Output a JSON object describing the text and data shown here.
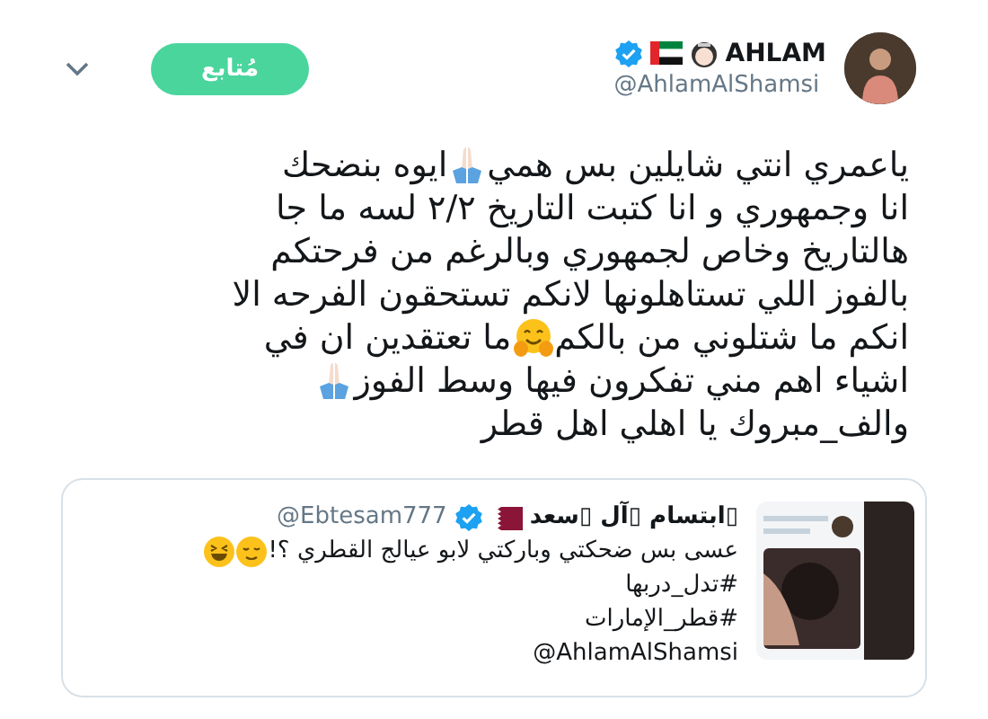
{
  "author": {
    "name": "AHLAM",
    "handle": "@AhlamAlShamsi",
    "verified": true
  },
  "follow_button": {
    "label": "مُتابع"
  },
  "tweet_lines": [
    [
      {
        "kind": "text",
        "text": "ياعمري انتي شايلين بس همي"
      },
      {
        "kind": "pray-emoji"
      },
      {
        "kind": "text",
        "text": " ايوه بنضحك"
      }
    ],
    [
      {
        "kind": "text",
        "text": "انا وجمهوري و انا كتبت التاريخ ٢/٢ لسه ما جا"
      }
    ],
    [
      {
        "kind": "text",
        "text": "هالتاريخ وخاص لجمهوري وبالرغم من فرحتكم"
      }
    ],
    [
      {
        "kind": "text",
        "text": "بالفوز اللي تستاهلونها لانكم تستحقون الفرحه الا"
      }
    ],
    [
      {
        "kind": "text",
        "text": "انكم ما شتلوني من بالكم"
      },
      {
        "kind": "hug-emoji"
      },
      {
        "kind": "text",
        "text": "ما تعتقدين ان في"
      }
    ],
    [
      {
        "kind": "text",
        "text": "اشياء اهم مني تفكرون فيها وسط الفوز "
      },
      {
        "kind": "pray-emoji"
      }
    ],
    [
      {
        "kind": "text",
        "text": "والف_مبروك يا اهلي اهل قطر"
      }
    ]
  ],
  "quoted_tweet": {
    "name": "▯ابتسام ▯آل ▯سعد",
    "handle": "@Ebtesam777",
    "verified": true,
    "media": {
      "kind": "picture"
    },
    "lines": [
      [
        {
          "kind": "text",
          "text": "عسى بس ضحكتي وباركتي لابو عيالج القطري ؟! "
        },
        {
          "kind": "relieved-emoji"
        },
        {
          "kind": "grin-emoji"
        }
      ],
      [
        {
          "kind": "text",
          "text": "#تدل_دربها"
        }
      ],
      [
        {
          "kind": "text",
          "text": "#قطر_الإمارات"
        }
      ],
      [
        {
          "kind": "text",
          "text": "@AhlamAlShamsi"
        }
      ]
    ]
  }
}
